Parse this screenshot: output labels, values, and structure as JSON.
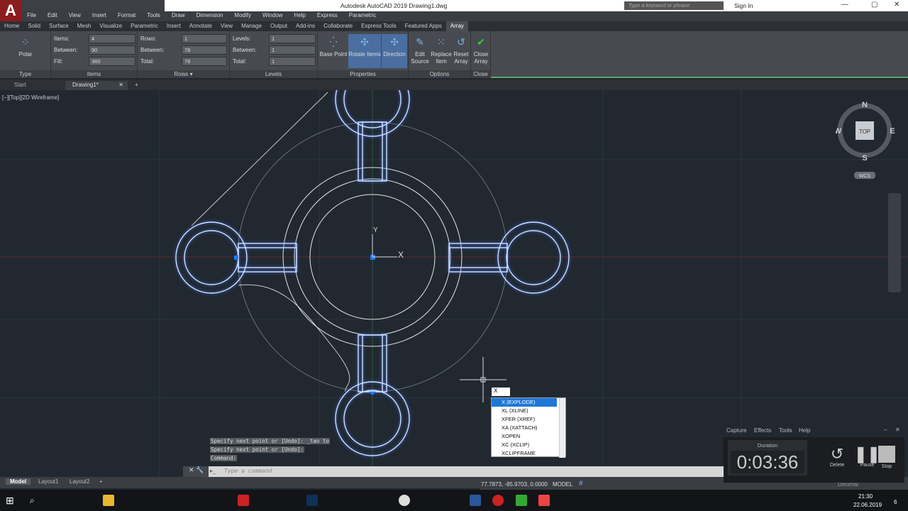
{
  "app": {
    "title": "Autodesk AutoCAD 2019   Drawing1.dwg",
    "logo": "A",
    "search_placeholder": "Type a keyword or phrase",
    "sign_in": "Sign In"
  },
  "menu": [
    "File",
    "Edit",
    "View",
    "Insert",
    "Format",
    "Tools",
    "Draw",
    "Dimension",
    "Modify",
    "Window",
    "Help",
    "Express",
    "Parametric"
  ],
  "ribbon_tabs": [
    "Home",
    "Solid",
    "Surface",
    "Mesh",
    "Visualize",
    "Parametric",
    "Insert",
    "Annotate",
    "View",
    "Manage",
    "Output",
    "Add-ins",
    "Collaborate",
    "Express Tools",
    "Featured Apps",
    "Array"
  ],
  "ribbon": {
    "type": {
      "button": "Polar",
      "label": "Type"
    },
    "items": {
      "label": "Items",
      "items_label": "Items:",
      "items": "4",
      "between_label": "Between:",
      "between": "90",
      "fill_label": "Fill:",
      "fill": "360"
    },
    "rows": {
      "label": "Rows ▾",
      "rows_label": "Rows:",
      "rows": "1",
      "between_label": "Between:",
      "between": "78",
      "total_label": "Total:",
      "total": "78"
    },
    "levels": {
      "label": "Levels",
      "levels_label": "Levels:",
      "levels": "1",
      "between_label": "Between:",
      "between": "1",
      "total_label": "Total:",
      "total": "1"
    },
    "properties": {
      "label": "Properties",
      "base_point": "Base Point",
      "rotate_items": "Rotate Items",
      "direction": "Direction"
    },
    "options": {
      "label": "Options",
      "edit_source": [
        "Edit",
        "Source"
      ],
      "replace_item": [
        "Replace",
        "Item"
      ],
      "reset_array": [
        "Reset",
        "Array"
      ]
    },
    "close": {
      "label": "Close",
      "close_array": [
        "Close",
        "Array"
      ]
    }
  },
  "file_tabs": {
    "start": "Start",
    "drawing": "Drawing1*"
  },
  "viewport_label": "[−][Top][2D Wireframe]",
  "viewcube": {
    "n": "N",
    "s": "S",
    "e": "E",
    "w": "W",
    "top": "TOP",
    "wcs": "WCS"
  },
  "ucs": {
    "x": "X",
    "y": "Y"
  },
  "command_history": [
    "Specify next point or [Undo]: _tan to",
    "Specify next point or [Undo]:",
    "Command:"
  ],
  "command_placeholder": "Type a command",
  "autocomplete": {
    "input": "X",
    "items": [
      "X (EXPLODE)",
      "XL (XLINE)",
      "XFER (XREF)",
      "XA (XATTACH)",
      "XOPEN",
      "XC (XCLIP)",
      "XCLIPFRAME"
    ]
  },
  "layout_tabs": [
    "Model",
    "Layout1",
    "Layout2"
  ],
  "status": {
    "coords": "77.7873, -85.9703, 0.0000",
    "space": "MODEL",
    "units": "Decimal"
  },
  "recorder": {
    "menu": [
      "Capture",
      "Effects",
      "Tools",
      "Help"
    ],
    "duration_label": "Duration",
    "time": "0:03:36",
    "delete": "Delete",
    "pause": "Pause",
    "stop": "Stop"
  },
  "taskbar": {
    "time": "21:30",
    "date": "22.06.2019",
    "notifications": "6"
  },
  "colors": {
    "canvas": "#212830",
    "selection": "#8fb4ff",
    "accent": "#1e78d7"
  }
}
